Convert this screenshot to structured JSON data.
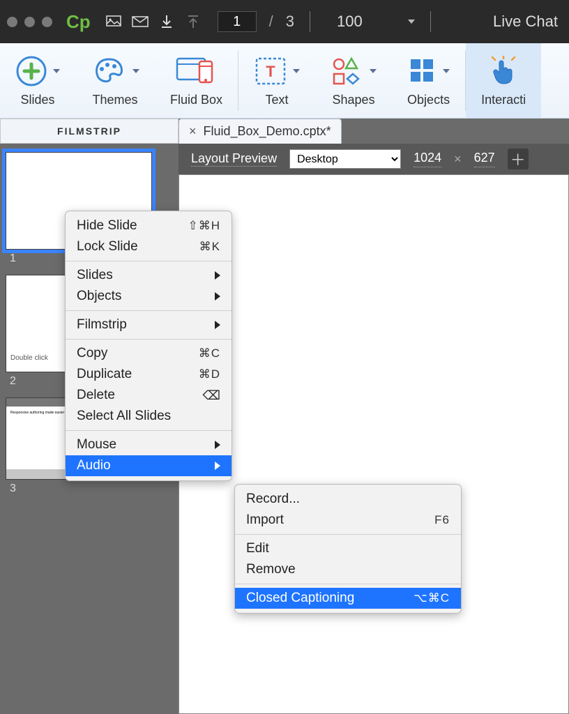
{
  "app": {
    "logo_text": "Cp"
  },
  "topbar": {
    "current_page": "1",
    "total_pages": "3",
    "zoom": "100",
    "live_chat": "Live Chat"
  },
  "ribbon": {
    "slides": "Slides",
    "themes": "Themes",
    "fluid_box": "Fluid Box",
    "text": "Text",
    "shapes": "Shapes",
    "objects": "Objects",
    "interactions": "Interacti"
  },
  "filmstrip": {
    "title": "FILMSTRIP",
    "slides": [
      {
        "num": "1"
      },
      {
        "num": "2",
        "caption": "Double click"
      },
      {
        "num": "3",
        "heading": "Responsive authoring made easier and faster!"
      }
    ]
  },
  "document": {
    "tab_name": "Fluid_Box_Demo.cptx*",
    "layout_preview_label": "Layout Preview",
    "device": "Desktop",
    "width": "1024",
    "height": "627"
  },
  "context_menu": {
    "hide_slide": "Hide Slide",
    "hide_slide_shortcut": "⇧⌘H",
    "lock_slide": "Lock Slide",
    "lock_slide_shortcut": "⌘K",
    "slides": "Slides",
    "objects": "Objects",
    "filmstrip": "Filmstrip",
    "copy": "Copy",
    "copy_shortcut": "⌘C",
    "duplicate": "Duplicate",
    "duplicate_shortcut": "⌘D",
    "delete": "Delete",
    "select_all": "Select All Slides",
    "mouse": "Mouse",
    "audio": "Audio"
  },
  "audio_submenu": {
    "record": "Record...",
    "import": "Import",
    "import_shortcut": "F6",
    "edit": "Edit",
    "remove": "Remove",
    "closed_captioning": "Closed Captioning",
    "cc_shortcut": "⌥⌘C"
  }
}
